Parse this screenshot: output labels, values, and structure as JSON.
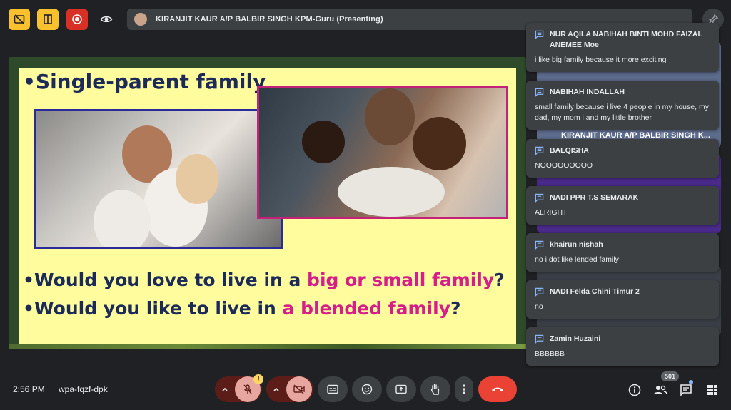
{
  "presenting": {
    "text": "KIRANJIT KAUR A/P BALBIR SINGH KPM-Guru (Presenting)"
  },
  "slide": {
    "title": "•Single-parent family",
    "q1_prefix": "•Would you love to live in a ",
    "q1_highlight": "big or small family",
    "q1_suffix": "?",
    "q2_prefix": "•Would you like to live in ",
    "q2_highlight": "a blended family",
    "q2_suffix": "?"
  },
  "tiles": {
    "presenter_name": "KIRANJIT KAUR A/P BALBIR SINGH K..."
  },
  "chats": [
    {
      "sender": "NUR AQILA NABIHAH BINTI MOHD FAIZAL ANEMEE Moe",
      "message": "i like big family because it more exciting"
    },
    {
      "sender": "NABIHAH INDALLAH",
      "message": "small family because i live 4 people in my house, my dad, my mom i and my little brother"
    },
    {
      "sender": "BALQISHA",
      "message": "NOOOOOOOOO"
    },
    {
      "sender": "NADI PPR T.S SEMARAK",
      "message": "ALRIGHT"
    },
    {
      "sender": "khairun nishah",
      "message": "no i dot like lended family"
    },
    {
      "sender": "NADI Felda Chini Timur 2",
      "message": "no"
    },
    {
      "sender": "Zamin Huzaini",
      "message": "BBBBBB"
    }
  ],
  "bottom": {
    "time": "2:56 PM",
    "meeting_code": "wpa-fqzf-dpk",
    "warning": "!",
    "participants_count": "501"
  },
  "icons": {
    "top": [
      "no-cc-icon",
      "layout-icon",
      "record-icon",
      "eye-icon",
      "pin-icon"
    ],
    "bottom": [
      "chevron-up-icon",
      "mic-off-icon",
      "chevron-up-icon",
      "camera-off-icon",
      "captions-icon",
      "emoji-icon",
      "present-icon",
      "raise-hand-icon",
      "more-vert-icon",
      "end-call-icon",
      "info-icon",
      "people-icon",
      "chat-icon",
      "activities-icon"
    ]
  },
  "colors": {
    "background": "#202124",
    "slide_bg": "#fefc9c",
    "slide_text": "#1c2a59",
    "highlight": "#d61e8a",
    "end_call": "#ea4335",
    "chat_bubble": "#3c4043"
  }
}
